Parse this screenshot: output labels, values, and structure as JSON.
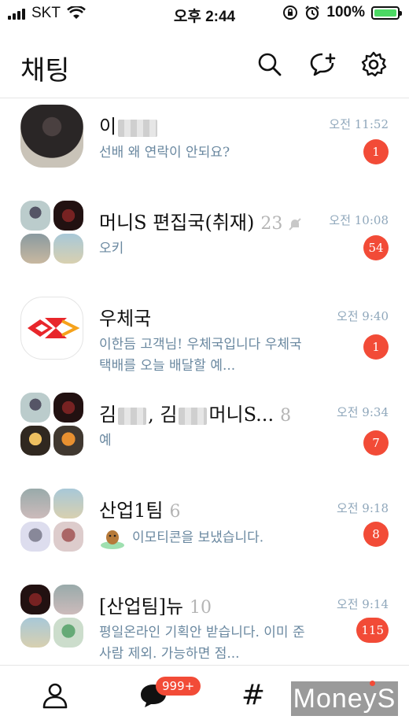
{
  "status_bar": {
    "carrier": "SKT",
    "time": "오후 2:44",
    "battery": "100%"
  },
  "header": {
    "title": "채팅"
  },
  "chats": [
    {
      "name_prefix": "이",
      "name_suffix": "",
      "count": "",
      "preview": "선배 왜 연락이 안되요?",
      "time": "오전 11:52",
      "badge": "1",
      "avatar": "single-person"
    },
    {
      "name": "머니S 편집국(취재)",
      "count": "23",
      "muted": true,
      "preview": "오키",
      "time": "오전 10:08",
      "badge": "54",
      "avatar": "group"
    },
    {
      "name": "우체국",
      "count": "",
      "preview": "이한듬 고객님! 우체국입니다 우체국택배를 오늘 배달할 예...",
      "time": "오전 9:40",
      "badge": "1",
      "avatar": "post-office-logo"
    },
    {
      "name_prefix": "김",
      "name_middle": ", 김",
      "name_suffix": "머니S...",
      "count": "8",
      "preview": "예",
      "time": "오전 9:34",
      "badge": "7",
      "avatar": "group"
    },
    {
      "name": "산업1팀",
      "count": "6",
      "preview": "이모티콘을 보냈습니다.",
      "time": "오전 9:18",
      "badge": "8",
      "avatar": "group"
    },
    {
      "name": "[산업팀]뉴",
      "count": "10",
      "preview": "평일온라인 기획안 받습니다. 이미 준 사람 제외. 가능하면 점...",
      "time": "오전 9:14",
      "badge": "115",
      "avatar": "group"
    }
  ],
  "bottom_nav": {
    "chat_badge": "999+",
    "items": [
      "friends-icon",
      "chat-icon",
      "hashtag-icon",
      "more-icon"
    ]
  },
  "watermark": "MoneyS",
  "colors": {
    "badge": "#f24b37",
    "preview_text": "#6a88a0",
    "time_text": "#8fa7bb",
    "battery": "#4cd964"
  }
}
